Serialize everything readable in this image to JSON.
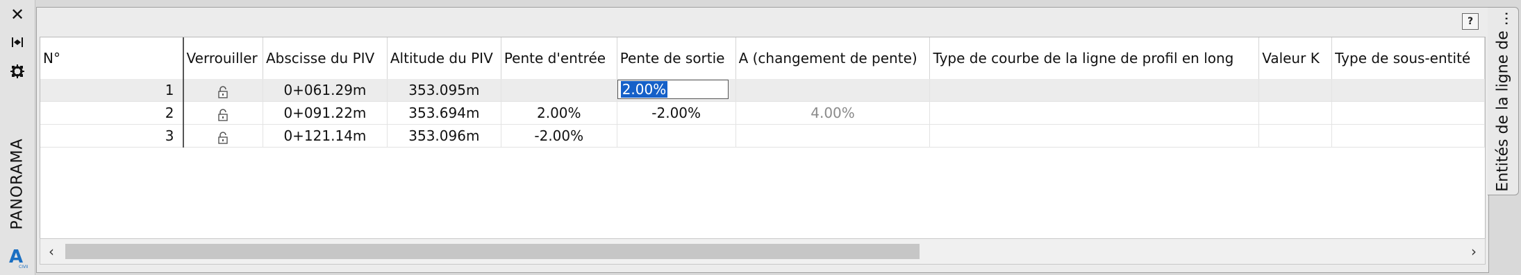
{
  "palette": {
    "select_accent": "#1560c8",
    "row_highlight": "#ececec",
    "grey_text": "#8a8a8a"
  },
  "titlebar": {
    "close_icon": "close-icon",
    "autohide_icon": "autohide-icon",
    "properties_icon": "properties-icon",
    "label": "PANORAMA",
    "app_icon": "autocad-civil-icon"
  },
  "panel": {
    "help_label": "?"
  },
  "columns": [
    "N°",
    "Verrouiller",
    "Abscisse du PIV",
    "Altitude du PIV",
    "Pente d'entrée",
    "Pente de sortie",
    "A (changement de pente)",
    "Type de courbe de la ligne de profil en long",
    "Valeur K",
    "Type de sous-entité"
  ],
  "rows": [
    {
      "num": "1",
      "station": "0+061.29m",
      "elevation": "353.095m",
      "grade_in": "",
      "grade_out": "2.00%",
      "a_change": "",
      "curve_type": "",
      "k_value": "",
      "sub_type": "",
      "selected": true,
      "editing": true
    },
    {
      "num": "2",
      "station": "0+091.22m",
      "elevation": "353.694m",
      "grade_in": "2.00%",
      "grade_out": "-2.00%",
      "a_change": "4.00%",
      "curve_type": "",
      "k_value": "",
      "sub_type": "",
      "selected": false,
      "editing": false
    },
    {
      "num": "3",
      "station": "0+121.14m",
      "elevation": "353.096m",
      "grade_in": "-2.00%",
      "grade_out": "",
      "a_change": "",
      "curve_type": "",
      "k_value": "",
      "sub_type": "",
      "selected": false,
      "editing": false
    }
  ],
  "scrollbar": {
    "left_arrow": "‹",
    "right_arrow": "›"
  },
  "side_tab": {
    "label": "Entités de la ligne de ..."
  }
}
